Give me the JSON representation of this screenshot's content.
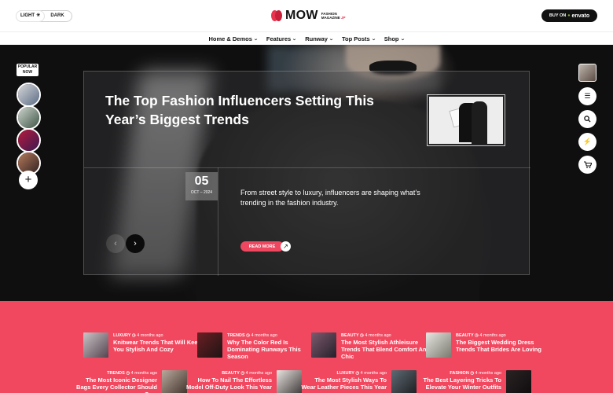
{
  "topbar": {
    "mode_light": "LIGHT",
    "mode_dark": "DARK",
    "logo_text": "MOW",
    "logo_sub_1": "FASHION",
    "logo_sub_2": "MAGAZINE",
    "logo_sub_suffix": "JP",
    "buy_label": "BUY ON",
    "buy_brand": "envato"
  },
  "nav": [
    {
      "label": "Home & Demos"
    },
    {
      "label": "Features"
    },
    {
      "label": "Runway"
    },
    {
      "label": "Top Posts"
    },
    {
      "label": "Shop"
    }
  ],
  "hero": {
    "title": "The Top Fashion Influencers Setting This Year’s Biggest Trends",
    "day": "05",
    "month_year": "OCT – 2024",
    "description": "From street style to luxury, influencers are shaping what’s trending in the fashion industry.",
    "read_more": "READ MORE",
    "popular_badge": "POPULAR NOW"
  },
  "colors": {
    "accent": "#f2485f",
    "read_more": "#ef4760",
    "dark": "#111111"
  },
  "posts_row1": [
    {
      "category": "LUXURY",
      "time": "4 months ago",
      "title": "Knitwear Trends That Will Keep You Stylish And Cozy"
    },
    {
      "category": "TRENDS",
      "time": "4 months ago",
      "title": "Why The Color Red Is Dominating Runways This Season"
    },
    {
      "category": "BEAUTY",
      "time": "4 months ago",
      "title": "The Most Stylish Athleisure Trends That Blend Comfort And Chic"
    },
    {
      "category": "BEAUTY",
      "time": "4 months ago",
      "title": "The Biggest Wedding Dress Trends That Brides Are Loving"
    }
  ],
  "posts_row2": [
    {
      "category": "TRENDS",
      "time": "4 months ago",
      "title": "The Most Iconic Designer Bags Every Collector Should Own"
    },
    {
      "category": "BEAUTY",
      "time": "4 months ago",
      "title": "How To Nail The Effortless Model Off-Duty Look This Year"
    },
    {
      "category": "LUXURY",
      "time": "4 months ago",
      "title": "The Most Stylish Ways To Wear Leather Pieces This Year"
    },
    {
      "category": "FASHION",
      "time": "4 months ago",
      "title": "The Best Layering Tricks To Elevate Your Winter Outfits"
    }
  ]
}
